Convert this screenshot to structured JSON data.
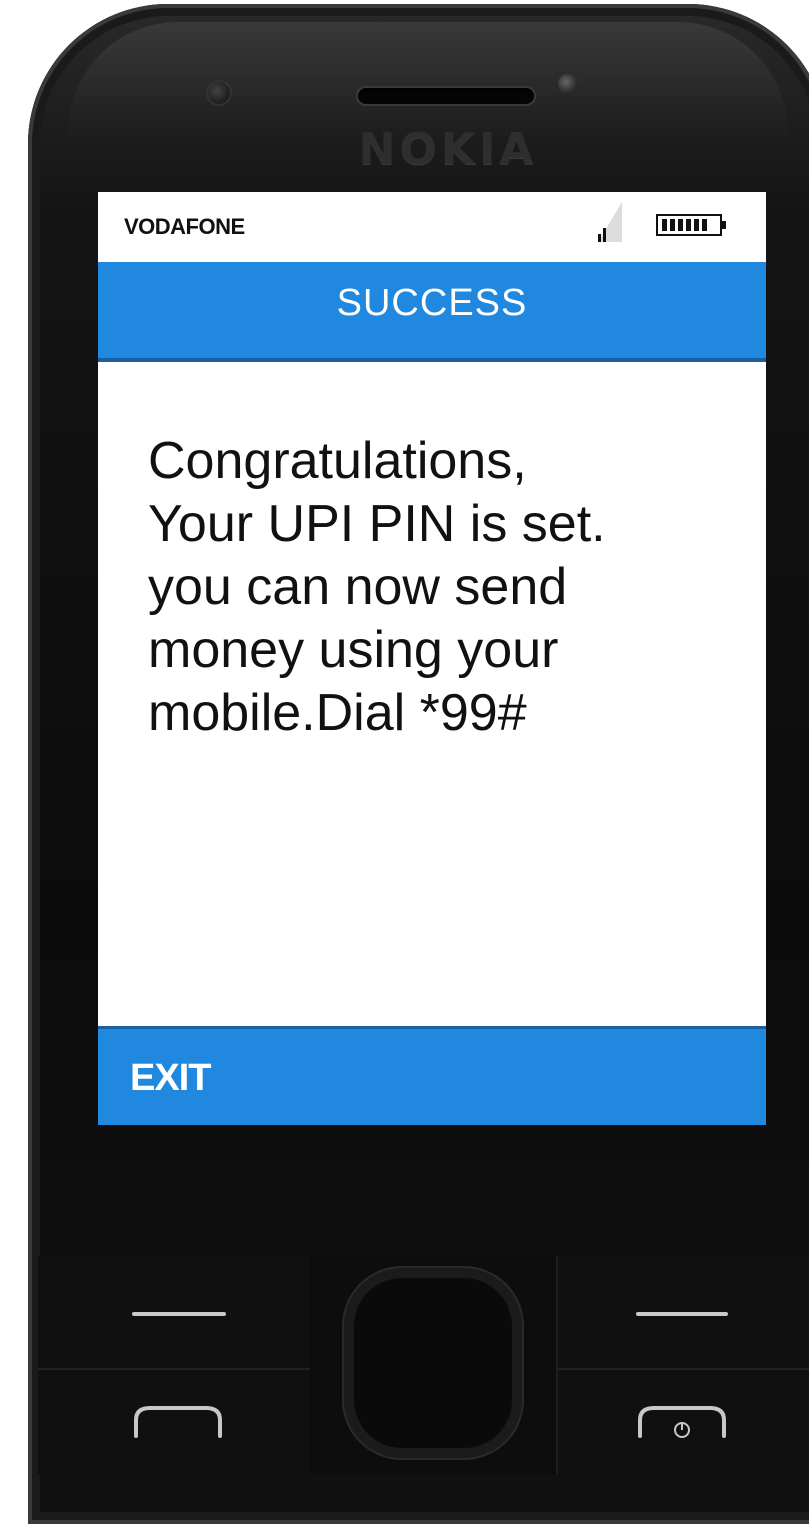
{
  "device": {
    "brand": "NOKIA"
  },
  "status_bar": {
    "carrier": "VODAFONE",
    "signal_icon": "signal-icon",
    "battery_icon": "battery-icon"
  },
  "screen": {
    "title": "SUCCESS",
    "message": "Congratulations,\nYour UPI PIN is set.\nyou can now send\nmoney using your\nmobile.Dial *99#",
    "left_softkey": "EXIT"
  },
  "colors": {
    "accent": "#2188e0",
    "body": "#0b0b0b",
    "screen_bg": "#ffffff"
  }
}
